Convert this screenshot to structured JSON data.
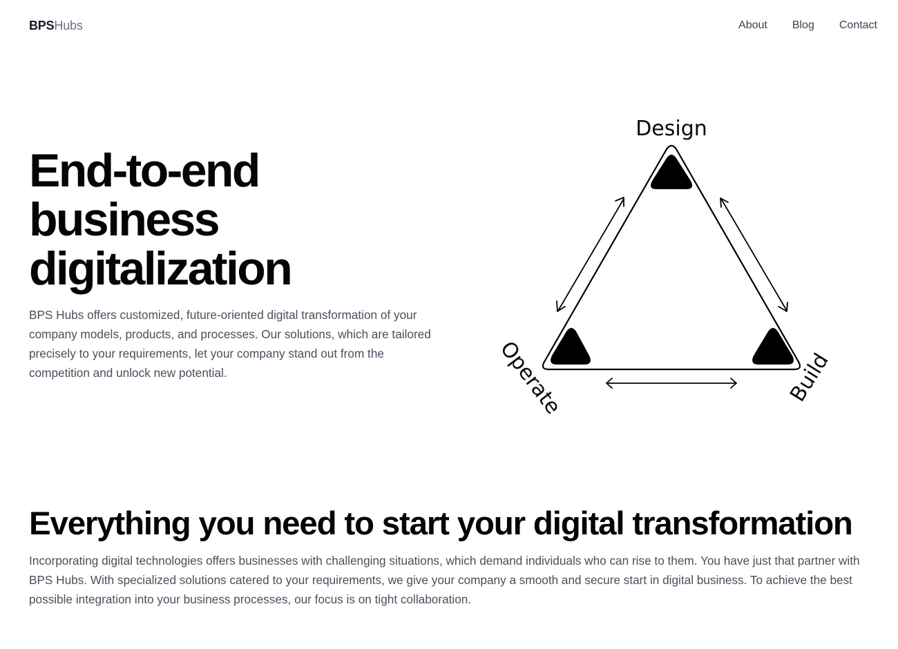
{
  "header": {
    "logo_strong": "BPS",
    "logo_light": "Hubs",
    "nav": [
      {
        "label": "About"
      },
      {
        "label": "Blog"
      },
      {
        "label": "Contact"
      }
    ]
  },
  "hero": {
    "title_lines": [
      "End-to-end",
      "business",
      "digitalization"
    ],
    "description": "BPS Hubs offers customized, future-oriented digital transformation of your company models, products, and processes. Our solutions, which are tailored precisely to your requirements, let your company stand out from the competition and unlock new potential."
  },
  "diagram": {
    "top_label": "Design",
    "right_label": "Build",
    "left_label": "Operate"
  },
  "section": {
    "title": "Everything you need to start your digital transformation",
    "description": "Incorporating digital technologies offers businesses with challenging situations, which demand individuals who can rise to them. You have just that partner with BPS Hubs. With specialized solutions catered to your requirements, we give your company a smooth and secure start in digital business. To achieve the best possible integration into your business processes, our focus is on tight collaboration."
  },
  "colors": {
    "text_dark": "#050507",
    "text_body": "#4a4f5c",
    "nav": "#3c4150",
    "logo_strong": "#141a2e",
    "logo_light": "#6b7180"
  }
}
